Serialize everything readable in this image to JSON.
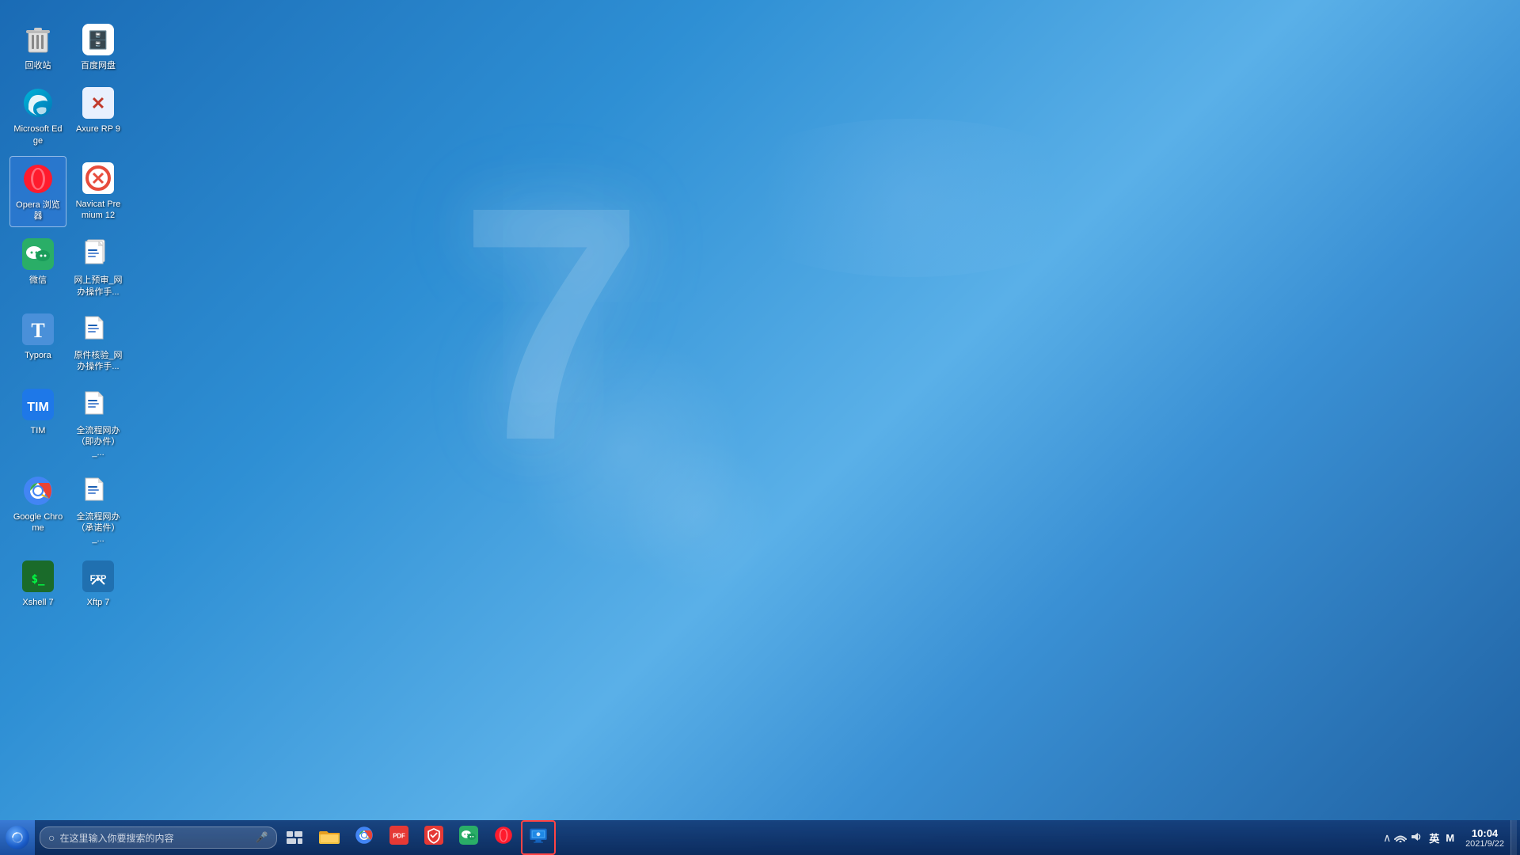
{
  "desktop": {
    "background_color_start": "#1a6bb5",
    "background_color_end": "#5ab0e8",
    "win7_logo": "7"
  },
  "icons": {
    "rows": [
      [
        {
          "id": "recycle-bin",
          "label": "回收站",
          "type": "recycle"
        },
        {
          "id": "baidu-netdisk",
          "label": "百度网盘",
          "type": "baidu"
        }
      ],
      [
        {
          "id": "microsoft-edge",
          "label": "Microsoft Edge",
          "type": "edge"
        },
        {
          "id": "axure-rp9",
          "label": "Axure RP 9",
          "type": "axure"
        }
      ],
      [
        {
          "id": "opera-browser",
          "label": "Opera 浏览器",
          "type": "opera",
          "selected": true
        },
        {
          "id": "navicat-premium",
          "label": "Navicat Premium 12",
          "type": "navicat"
        }
      ],
      [
        {
          "id": "wechat",
          "label": "微信",
          "type": "wechat"
        },
        {
          "id": "doc-yulan",
          "label": "网上预审_网办操作手...",
          "type": "doc"
        }
      ],
      [
        {
          "id": "typora",
          "label": "Typora",
          "type": "typora"
        },
        {
          "id": "doc-yuanjian",
          "label": "原件核验_网办操作手...",
          "type": "doc"
        }
      ],
      [
        {
          "id": "tim",
          "label": "TIM",
          "type": "tim"
        },
        {
          "id": "doc-quanliucheng1",
          "label": "全流程网办（即办件）_...",
          "type": "doc"
        }
      ],
      [
        {
          "id": "google-chrome",
          "label": "Google Chrome",
          "type": "chrome"
        },
        {
          "id": "doc-quanliucheng2",
          "label": "全流程网办（承诺件）_...",
          "type": "doc"
        }
      ],
      [
        {
          "id": "xshell7",
          "label": "Xshell 7",
          "type": "xshell"
        },
        {
          "id": "xftp7",
          "label": "Xftp 7",
          "type": "xftp"
        }
      ]
    ]
  },
  "taskbar": {
    "search_placeholder": "在这里输入你要搜索的内容",
    "apps": [
      {
        "id": "file-explorer",
        "label": "文件资源管理器",
        "type": "explorer"
      },
      {
        "id": "chrome-taskbar",
        "label": "Google Chrome",
        "type": "chrome"
      },
      {
        "id": "pdf-viewer",
        "label": "PDF查看器",
        "type": "pdf"
      },
      {
        "id": "security",
        "label": "安全软件",
        "type": "shield"
      },
      {
        "id": "wechat-taskbar",
        "label": "微信",
        "type": "wechat"
      },
      {
        "id": "opera-taskbar",
        "label": "Opera",
        "type": "opera"
      },
      {
        "id": "remote-desktop",
        "label": "远程桌面",
        "type": "remote",
        "active": true,
        "highlighted": true
      }
    ],
    "tray": {
      "show_hidden": "显示隐藏图标",
      "network": "网络",
      "volume": "音量",
      "lang": "英",
      "ime": "M",
      "time": "10:04",
      "date": "2021/9/22"
    }
  }
}
